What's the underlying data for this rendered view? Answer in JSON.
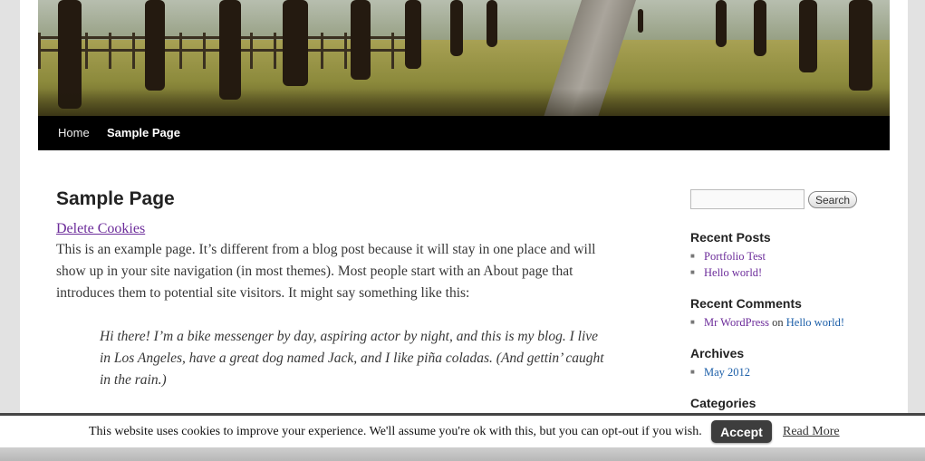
{
  "header": {
    "banner_alt": ""
  },
  "nav": {
    "items": [
      {
        "label": "Home"
      },
      {
        "label": "Sample Page"
      }
    ]
  },
  "main": {
    "title": "Sample Page",
    "delete_link": "Delete Cookies",
    "paragraph": "This is an example page. It’s different from a blog post because it will stay in one place and will show up in your site navigation (in most themes). Most people start with an About page that introduces them to potential site visitors. It might say something like this:",
    "quote": "Hi there! I’m a bike messenger by day, aspiring actor by night, and this is my blog. I live in Los Angeles, have a great dog named Jack, and I like piña coladas. (And gettin’ caught in the rain.)"
  },
  "sidebar": {
    "search": {
      "value": "",
      "button_label": "Search"
    },
    "recent_posts": {
      "title": "Recent Posts",
      "items": [
        "Portfolio Test",
        "Hello world!"
      ]
    },
    "recent_comments": {
      "title": "Recent Comments",
      "author": "Mr WordPress",
      "connector": "on",
      "post": "Hello world!"
    },
    "archives": {
      "title": "Archives",
      "items": [
        "May 2012"
      ]
    },
    "categories": {
      "title": "Categories"
    }
  },
  "cookie_bar": {
    "text": "This website uses cookies to improve your experience. We'll assume you're ok with this, but you can opt-out if you wish.",
    "accept_label": "Accept",
    "read_more_label": "Read More"
  },
  "colors": {
    "nav_bg": "#000000",
    "link_purple": "#6c2c9a",
    "link_blue": "#1b5ea8",
    "accept_bg": "#3d3d3d"
  }
}
